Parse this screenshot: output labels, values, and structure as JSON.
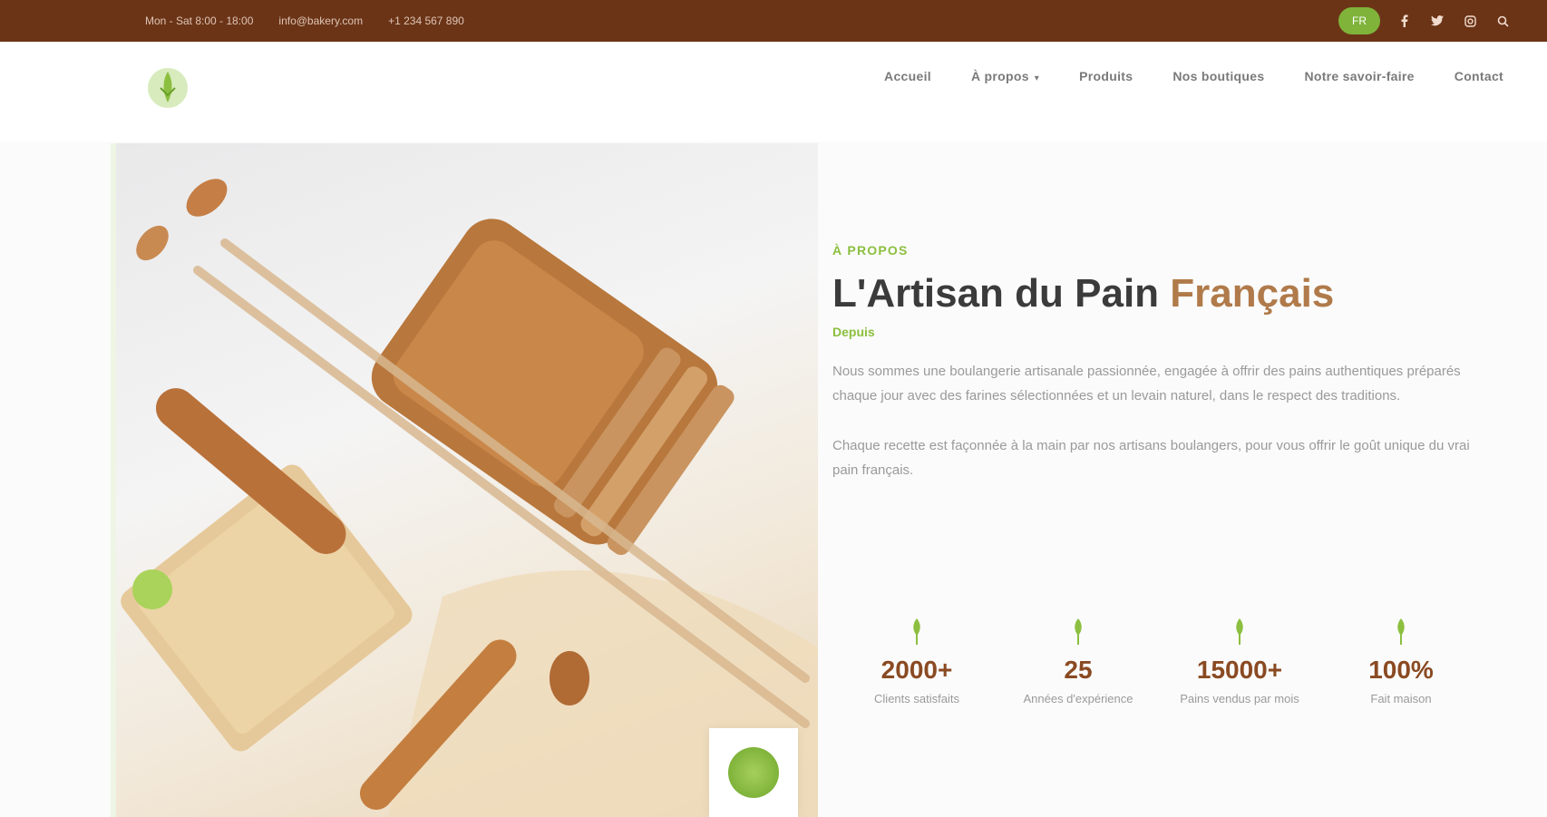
{
  "colors": {
    "topbar": "#6b3417",
    "brand_green": "#7fb33a",
    "accent_brown": "#b07a4a",
    "stat_brown": "#8a4a22"
  },
  "topbar": {
    "left_items": [
      "Mon - Sat 8:00 - 18:00",
      "info@bakery.com",
      "+1 234 567 890"
    ],
    "badge_label": "FR",
    "icons": [
      "facebook-icon",
      "twitter-icon",
      "instagram-icon",
      "search-icon"
    ]
  },
  "header": {
    "logo_name": "bakery-logo-icon",
    "nav": [
      {
        "label": "Accueil",
        "has_caret": false
      },
      {
        "label": "À propos",
        "has_caret": true
      },
      {
        "label": "Produits",
        "has_caret": false
      },
      {
        "label": "Nos boutiques",
        "has_caret": false
      },
      {
        "label": "Notre savoir-faire",
        "has_caret": false
      },
      {
        "label": "Contact",
        "has_caret": false
      }
    ]
  },
  "main": {
    "eyebrow": "À PROPOS",
    "title_main": "L'Artisan du Pain ",
    "title_accent": "Français",
    "subline": "Depuis",
    "paragraphs": [
      "Nous sommes une boulangerie artisanale passionnée, engagée à offrir des pains authentiques préparés chaque jour avec des farines sélectionnées et un levain naturel, dans le respect des traditions.",
      "Chaque recette est façonnée à la main par nos artisans boulangers, pour vous offrir le goût unique du vrai pain français."
    ],
    "stats": [
      {
        "icon": "wheat-icon",
        "value": "2000+",
        "label": "Clients satisfaits"
      },
      {
        "icon": "wheat-icon",
        "value": "25",
        "label": "Années d'expérience"
      },
      {
        "icon": "wheat-icon",
        "value": "15000+",
        "label": "Pains vendus par mois"
      },
      {
        "icon": "wheat-icon",
        "value": "100%",
        "label": "Fait maison"
      }
    ]
  },
  "hero": {
    "badge_icon": "leaf-seal-icon"
  }
}
